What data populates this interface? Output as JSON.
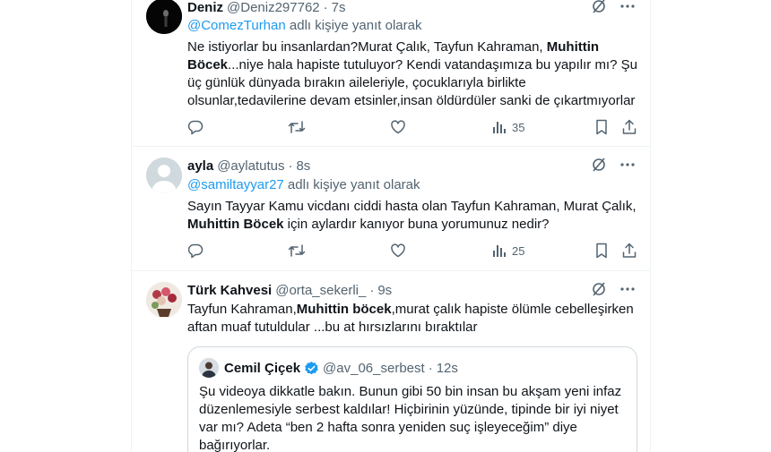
{
  "tweets": [
    {
      "name": "Deniz",
      "handle": "@Deniz297762",
      "time": "7s",
      "reply_mention": "@ComezTurhan",
      "reply_suffix": " adlı kişiye yanıt olarak",
      "body": [
        {
          "t": "Ne istiyorlar bu insanlardan?Murat Çalık, Tayfun Kahraman, ",
          "b": false
        },
        {
          "t": "Muhittin Böcek",
          "b": true
        },
        {
          "t": "...niye hala hapiste tutuluyor? Kendi vatandaşımıza bu yapılır mı? Şu üç günlük dünyada bırakın aileleriyle, çocuklarıyla birlikte olsunlar,tedavilerine devam etsinler,insan öldürdüler sanki de çıkartmıyorlar",
          "b": false
        }
      ],
      "views": "35"
    },
    {
      "name": "ayla",
      "handle": "@aylatutus",
      "time": "8s",
      "reply_mention": "@samiltayyar27",
      "reply_suffix": " adlı kişiye yanıt olarak",
      "body": [
        {
          "t": "Sayın Tayyar Kamu vicdanı ciddi hasta olan Tayfun Kahraman, Murat Çalık, ",
          "b": false
        },
        {
          "t": "Muhittin Böcek",
          "b": true
        },
        {
          "t": " için aylardır kanıyor buna yorumunuz nedir?",
          "b": false
        }
      ],
      "views": "25"
    },
    {
      "name": "Türk Kahvesi",
      "handle": "@orta_sekerli_",
      "time": "9s",
      "body": [
        {
          "t": "Tayfun Kahraman,",
          "b": false
        },
        {
          "t": "Muhittin böcek",
          "b": true
        },
        {
          "t": ",murat çalık hapiste ölümle cebelleşirken aftan muaf tutuldular ...bu at hırsızlarını bıraktılar",
          "b": false
        }
      ],
      "quote": {
        "name": "Cemil Çiçek",
        "handle": "@av_06_serbest",
        "time": "12s",
        "verified_icon": "verified-badge-icon",
        "body": "Şu videoya dikkatle bakın. Bunun gibi 50 bin insan bu akşam yeni infaz düzenlemesiyle serbest kaldılar! Hiçbirinin yüzünde, tipinde bir iyi niyet var mı? Adeta “ben 2 hafta sonra yeniden suç işleyeceğim” diye bağırıyorlar."
      }
    }
  ],
  "dot": "·",
  "icons": {
    "reply": "reply-icon",
    "retweet": "retweet-icon",
    "like": "like-icon",
    "views": "views-icon",
    "bookmark": "bookmark-icon",
    "share": "share-icon",
    "grok": "grok-icon",
    "more": "more-icon"
  },
  "colors": {
    "accent": "#1d9bf0",
    "text": "#0f1419",
    "muted": "#536471",
    "border": "#eff3f4"
  }
}
